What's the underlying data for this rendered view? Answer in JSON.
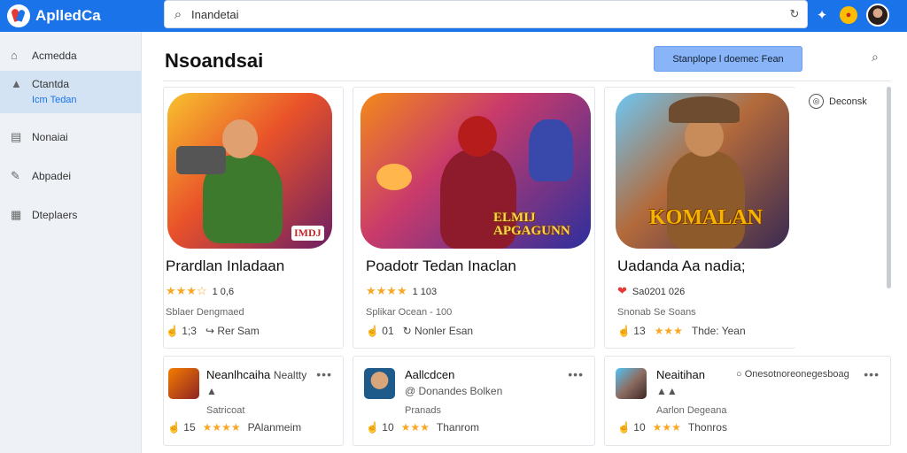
{
  "brand": {
    "name": "AplledCa"
  },
  "search": {
    "value": "Inandetai"
  },
  "sidebar": {
    "items": [
      {
        "label": "Acmedda",
        "sub": ""
      },
      {
        "label": "Ctantda",
        "sub": "Icm Tedan"
      },
      {
        "label": "Nonaiai",
        "sub": ""
      },
      {
        "label": "Abpadei",
        "sub": ""
      },
      {
        "label": "Dteplaers",
        "sub": ""
      }
    ]
  },
  "header": {
    "title": "Nsoandsai",
    "primary_button": "Stanplope l doemec Fean"
  },
  "bookmark": {
    "label": "Deconsk"
  },
  "featured": [
    {
      "title": "Prardlan Inladaan",
      "rating_text": "1 0,6",
      "meta": "Sblaer Dengmaed",
      "like_count": "1;3",
      "secondary": "Rer Sam",
      "art_caption": "IMDJ",
      "accent": "#f9a825"
    },
    {
      "title": "Poadotr Tedan Inaclan",
      "rating_text": "1 103",
      "meta": "Splikar Ocean - 100",
      "like_count": "01",
      "secondary": "Nonler Esan",
      "art_caption": "ELMIJ APGAGUNN",
      "accent": "#f9a825"
    },
    {
      "title": "Uadanda Aa nadia;",
      "rating_text": "Sa0201 026",
      "meta": "Snonab Se Soans",
      "like_count": "13",
      "secondary": "Thde: Yean",
      "art_caption": "KOMALAN",
      "accent": "#e53935"
    }
  ],
  "small_cards": [
    {
      "title": "Neanlhcaiha",
      "title_extra": "Nealtty",
      "sub": "",
      "line3": "Satricoat",
      "like_count": "15",
      "secondary": "PAlanmeim"
    },
    {
      "title": "Aallcdcen",
      "title_extra": "",
      "sub": "@ Donandes Bolken",
      "line3": "Pranads",
      "like_count": "10",
      "secondary": "Thanrom"
    },
    {
      "title": "Neaitihan",
      "title_extra": "",
      "sub": "",
      "line3": "Aarlon Degeana",
      "like_count": "10",
      "secondary": "Thonros",
      "badge": "Onesotnoreonegesboag"
    }
  ]
}
